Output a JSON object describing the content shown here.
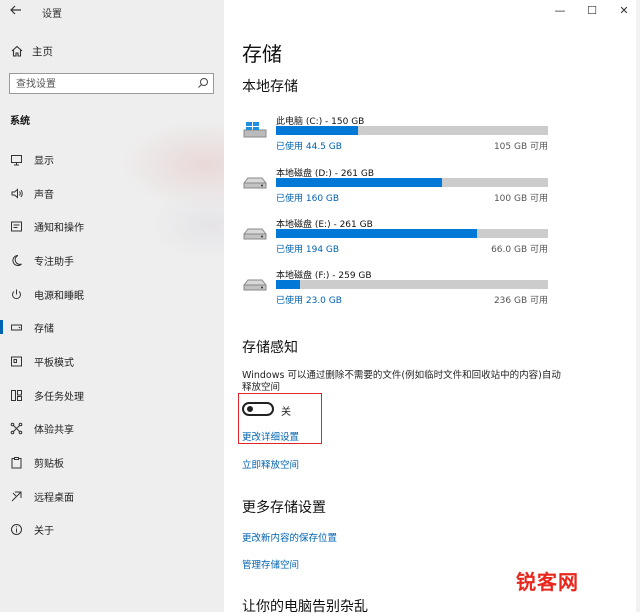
{
  "window": {
    "app_title": "设置",
    "controls": [
      "—",
      "☐",
      "✕"
    ]
  },
  "sidebar": {
    "home_label": "主页",
    "search_placeholder": "查找设置",
    "section_label": "系统",
    "items": [
      {
        "label": "显示",
        "icon": "monitor-icon"
      },
      {
        "label": "声音",
        "icon": "speaker-icon"
      },
      {
        "label": "通知和操作",
        "icon": "notification-icon"
      },
      {
        "label": "专注助手",
        "icon": "moon-icon"
      },
      {
        "label": "电源和睡眠",
        "icon": "power-icon"
      },
      {
        "label": "存储",
        "icon": "storage-icon",
        "active": true
      },
      {
        "label": "平板模式",
        "icon": "tablet-icon"
      },
      {
        "label": "多任务处理",
        "icon": "multitask-icon"
      },
      {
        "label": "体验共享",
        "icon": "share-icon"
      },
      {
        "label": "剪贴板",
        "icon": "clipboard-icon"
      },
      {
        "label": "远程桌面",
        "icon": "remote-icon"
      },
      {
        "label": "关于",
        "icon": "info-icon"
      }
    ]
  },
  "main": {
    "title": "存储",
    "local_storage_heading": "本地存储",
    "drives": [
      {
        "name": "此电脑 (C:) - 150 GB",
        "used": "已使用 44.5 GB",
        "free": "105 GB 可用",
        "used_fraction": 0.3,
        "icon": "windows-drive-icon"
      },
      {
        "name": "本地磁盘 (D:) - 261 GB",
        "used": "已使用 160 GB",
        "free": "100 GB 可用",
        "used_fraction": 0.61,
        "icon": "hard-drive-icon"
      },
      {
        "name": "本地磁盘 (E:) - 261 GB",
        "used": "已使用 194 GB",
        "free": "66.0 GB 可用",
        "used_fraction": 0.74,
        "icon": "hard-drive-icon"
      },
      {
        "name": "本地磁盘 (F:) - 259 GB",
        "used": "已使用 23.0 GB",
        "free": "236 GB 可用",
        "used_fraction": 0.09,
        "icon": "hard-drive-icon"
      }
    ],
    "storage_sense_heading": "存储感知",
    "storage_sense_desc": "Windows 可以通过删除不需要的文件(例如临时文件和回收站中的内容)自动释放空间",
    "toggle_state": "关",
    "change_settings_link": "更改详细设置",
    "free_up_link": "立即释放空间",
    "more_heading": "更多存储设置",
    "save_location_link": "更改新内容的保存位置",
    "manage_spaces_link": "管理存储空间",
    "bottom_heading": "让你的电脑告别杂乱"
  },
  "watermark": {
    "text": "锐客网"
  },
  "colors": {
    "accent": "#0078d7",
    "link": "#0063b1",
    "highlight_box": "#e0262b",
    "sidebar_bg": "#eeeeee"
  }
}
